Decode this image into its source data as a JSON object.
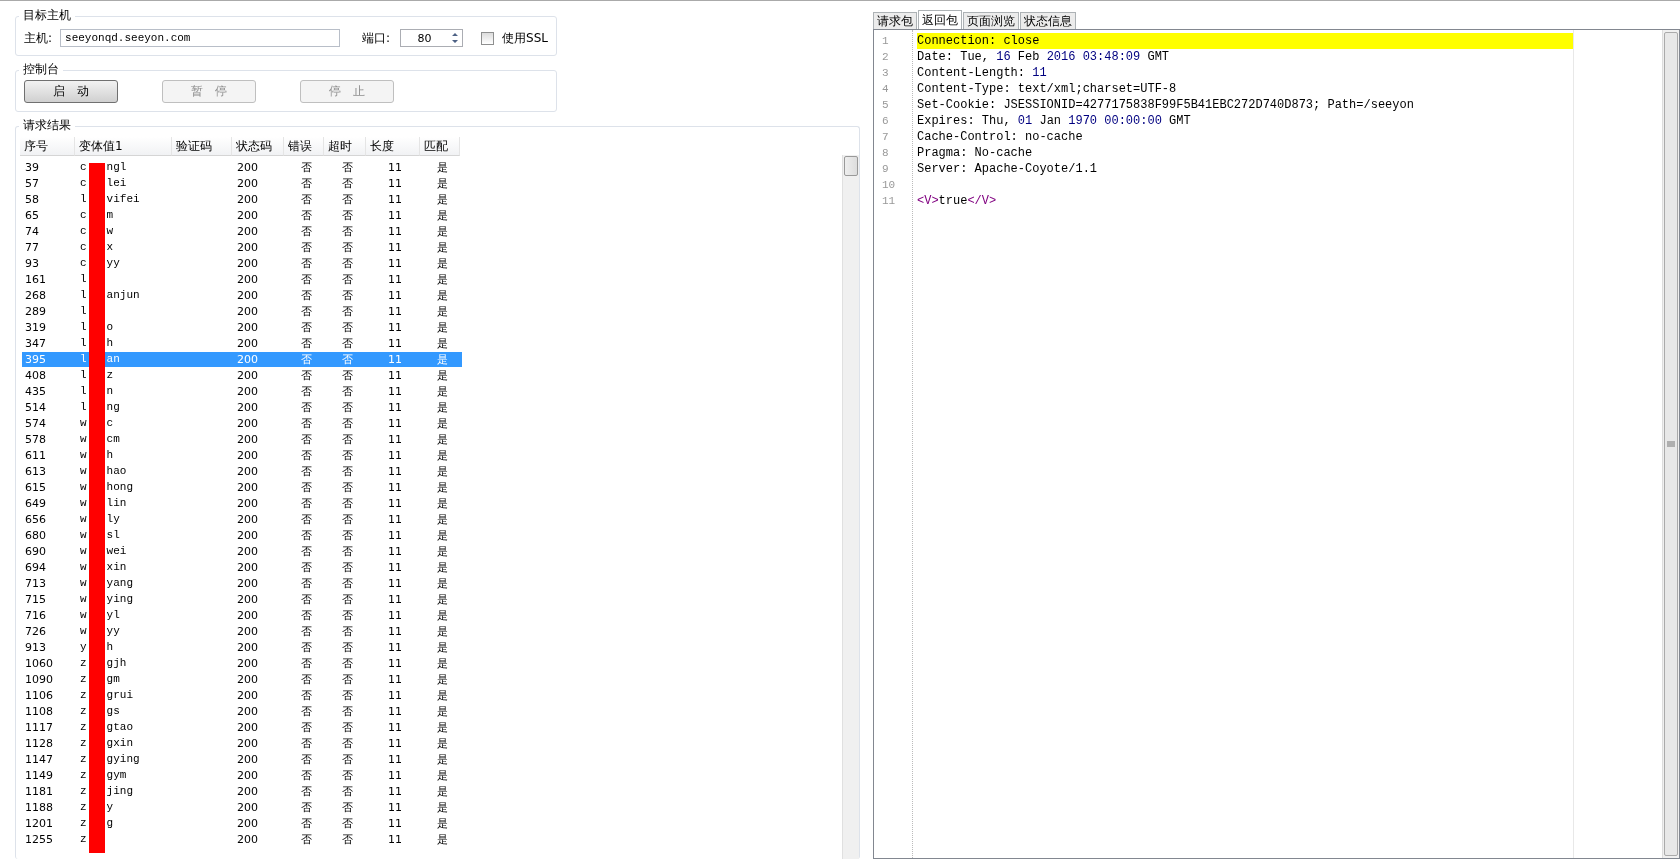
{
  "target_host": {
    "title": "目标主机",
    "host_label": "主机:",
    "host_value": "seeyonqd.seeyon.com",
    "port_label": "端口:",
    "port_value": "80",
    "ssl_label": "使用SSL",
    "ssl_checked": false
  },
  "console": {
    "title": "控制台",
    "buttons": [
      {
        "label": "启　动",
        "disabled": false
      },
      {
        "label": "暂　停",
        "disabled": true
      },
      {
        "label": "停　止",
        "disabled": true
      }
    ]
  },
  "results": {
    "title": "请求结果",
    "columns": [
      "序号",
      "变体值1",
      "验证码",
      "状态码",
      "错误",
      "超时",
      "长度",
      "匹配"
    ],
    "rows": [
      {
        "id": "39",
        "head": "c",
        "tail": "ngl",
        "status": "200",
        "error": "否",
        "timeout": "否",
        "length": "11",
        "match": "是",
        "selected": false
      },
      {
        "id": "57",
        "head": "c",
        "tail": "lei",
        "status": "200",
        "error": "否",
        "timeout": "否",
        "length": "11",
        "match": "是",
        "selected": false
      },
      {
        "id": "58",
        "head": "l",
        "tail": "vifei",
        "status": "200",
        "error": "否",
        "timeout": "否",
        "length": "11",
        "match": "是",
        "selected": false
      },
      {
        "id": "65",
        "head": "c",
        "tail": "m",
        "status": "200",
        "error": "否",
        "timeout": "否",
        "length": "11",
        "match": "是",
        "selected": false
      },
      {
        "id": "74",
        "head": "c",
        "tail": "w",
        "status": "200",
        "error": "否",
        "timeout": "否",
        "length": "11",
        "match": "是",
        "selected": false
      },
      {
        "id": "77",
        "head": "c",
        "tail": "x",
        "status": "200",
        "error": "否",
        "timeout": "否",
        "length": "11",
        "match": "是",
        "selected": false
      },
      {
        "id": "93",
        "head": "c",
        "tail": "yy",
        "status": "200",
        "error": "否",
        "timeout": "否",
        "length": "11",
        "match": "是",
        "selected": false
      },
      {
        "id": "161",
        "head": "l",
        "status": "200",
        "error": "否",
        "timeout": "否",
        "length": "11",
        "match": "是",
        "selected": false
      },
      {
        "id": "268",
        "head": "l",
        "tail": "anjun",
        "status": "200",
        "error": "否",
        "timeout": "否",
        "length": "11",
        "match": "是",
        "selected": false
      },
      {
        "id": "289",
        "head": "l",
        "status": "200",
        "error": "否",
        "timeout": "否",
        "length": "11",
        "match": "是",
        "selected": false
      },
      {
        "id": "319",
        "head": "l",
        "tail": "o",
        "status": "200",
        "error": "否",
        "timeout": "否",
        "length": "11",
        "match": "是",
        "selected": false
      },
      {
        "id": "347",
        "head": "l",
        "tail": "h",
        "status": "200",
        "error": "否",
        "timeout": "否",
        "length": "11",
        "match": "是",
        "selected": false
      },
      {
        "id": "395",
        "head": "l",
        "tail": "an",
        "status": "200",
        "error": "否",
        "timeout": "否",
        "length": "11",
        "match": "是",
        "selected": true
      },
      {
        "id": "408",
        "head": "l",
        "tail": "z",
        "status": "200",
        "error": "否",
        "timeout": "否",
        "length": "11",
        "match": "是",
        "selected": false
      },
      {
        "id": "435",
        "head": "l",
        "tail": "n",
        "status": "200",
        "error": "否",
        "timeout": "否",
        "length": "11",
        "match": "是",
        "selected": false
      },
      {
        "id": "514",
        "head": "l",
        "tail": "ng",
        "status": "200",
        "error": "否",
        "timeout": "否",
        "length": "11",
        "match": "是",
        "selected": false
      },
      {
        "id": "574",
        "head": "w",
        "tail": "c",
        "status": "200",
        "error": "否",
        "timeout": "否",
        "length": "11",
        "match": "是",
        "selected": false
      },
      {
        "id": "578",
        "head": "w",
        "tail": "cm",
        "status": "200",
        "error": "否",
        "timeout": "否",
        "length": "11",
        "match": "是",
        "selected": false
      },
      {
        "id": "611",
        "head": "w",
        "tail": "h",
        "status": "200",
        "error": "否",
        "timeout": "否",
        "length": "11",
        "match": "是",
        "selected": false
      },
      {
        "id": "613",
        "head": "w",
        "tail": "hao",
        "status": "200",
        "error": "否",
        "timeout": "否",
        "length": "11",
        "match": "是",
        "selected": false
      },
      {
        "id": "615",
        "head": "w",
        "tail": "hong",
        "status": "200",
        "error": "否",
        "timeout": "否",
        "length": "11",
        "match": "是",
        "selected": false
      },
      {
        "id": "649",
        "head": "w",
        "tail": "lin",
        "status": "200",
        "error": "否",
        "timeout": "否",
        "length": "11",
        "match": "是",
        "selected": false
      },
      {
        "id": "656",
        "head": "w",
        "tail": "ly",
        "status": "200",
        "error": "否",
        "timeout": "否",
        "length": "11",
        "match": "是",
        "selected": false
      },
      {
        "id": "680",
        "head": "w",
        "tail": "sl",
        "status": "200",
        "error": "否",
        "timeout": "否",
        "length": "11",
        "match": "是",
        "selected": false
      },
      {
        "id": "690",
        "head": "w",
        "tail": "wei",
        "status": "200",
        "error": "否",
        "timeout": "否",
        "length": "11",
        "match": "是",
        "selected": false
      },
      {
        "id": "694",
        "head": "w",
        "tail": "xin",
        "status": "200",
        "error": "否",
        "timeout": "否",
        "length": "11",
        "match": "是",
        "selected": false
      },
      {
        "id": "713",
        "head": "w",
        "tail": "yang",
        "status": "200",
        "error": "否",
        "timeout": "否",
        "length": "11",
        "match": "是",
        "selected": false
      },
      {
        "id": "715",
        "head": "w",
        "tail": "ying",
        "status": "200",
        "error": "否",
        "timeout": "否",
        "length": "11",
        "match": "是",
        "selected": false
      },
      {
        "id": "716",
        "head": "w",
        "tail": "yl",
        "status": "200",
        "error": "否",
        "timeout": "否",
        "length": "11",
        "match": "是",
        "selected": false
      },
      {
        "id": "726",
        "head": "w",
        "tail": "yy",
        "status": "200",
        "error": "否",
        "timeout": "否",
        "length": "11",
        "match": "是",
        "selected": false
      },
      {
        "id": "913",
        "head": "y",
        "tail": "h",
        "status": "200",
        "error": "否",
        "timeout": "否",
        "length": "11",
        "match": "是",
        "selected": false
      },
      {
        "id": "1060",
        "head": "z",
        "tail": "gjh",
        "status": "200",
        "error": "否",
        "timeout": "否",
        "length": "11",
        "match": "是",
        "selected": false
      },
      {
        "id": "1090",
        "head": "z",
        "tail": "gm",
        "status": "200",
        "error": "否",
        "timeout": "否",
        "length": "11",
        "match": "是",
        "selected": false
      },
      {
        "id": "1106",
        "head": "z",
        "tail": "grui",
        "status": "200",
        "error": "否",
        "timeout": "否",
        "length": "11",
        "match": "是",
        "selected": false
      },
      {
        "id": "1108",
        "head": "z",
        "tail": "gs",
        "status": "200",
        "error": "否",
        "timeout": "否",
        "length": "11",
        "match": "是",
        "selected": false
      },
      {
        "id": "1117",
        "head": "z",
        "tail": "gtao",
        "status": "200",
        "error": "否",
        "timeout": "否",
        "length": "11",
        "match": "是",
        "selected": false
      },
      {
        "id": "1128",
        "head": "z",
        "tail": "gxin",
        "status": "200",
        "error": "否",
        "timeout": "否",
        "length": "11",
        "match": "是",
        "selected": false
      },
      {
        "id": "1147",
        "head": "z",
        "tail": "gying",
        "status": "200",
        "error": "否",
        "timeout": "否",
        "length": "11",
        "match": "是",
        "selected": false
      },
      {
        "id": "1149",
        "head": "z",
        "tail": "gym",
        "status": "200",
        "error": "否",
        "timeout": "否",
        "length": "11",
        "match": "是",
        "selected": false
      },
      {
        "id": "1181",
        "head": "z",
        "tail": "jing",
        "status": "200",
        "error": "否",
        "timeout": "否",
        "length": "11",
        "match": "是",
        "selected": false
      },
      {
        "id": "1188",
        "head": "z",
        "tail": "y",
        "status": "200",
        "error": "否",
        "timeout": "否",
        "length": "11",
        "match": "是",
        "selected": false
      },
      {
        "id": "1201",
        "head": "z",
        "tail": "g",
        "status": "200",
        "error": "否",
        "timeout": "否",
        "length": "11",
        "match": "是",
        "selected": false
      },
      {
        "id": "1255",
        "head": "z",
        "status": "200",
        "error": "否",
        "timeout": "否",
        "length": "11",
        "match": "是",
        "selected": false
      }
    ]
  },
  "tabs": [
    {
      "label": "请求包",
      "selected": false
    },
    {
      "label": "返回包",
      "selected": true
    },
    {
      "label": "页面浏览",
      "selected": false
    },
    {
      "label": "状态信息",
      "selected": false
    }
  ],
  "response": {
    "lines": [
      {
        "number": "1",
        "highlighted": true,
        "segments": [
          {
            "kind": "plain",
            "text": "Connection: close"
          }
        ]
      },
      {
        "number": "2",
        "highlighted": false,
        "segments": [
          {
            "kind": "plain",
            "text": "Date: Tue, "
          },
          {
            "kind": "number",
            "text": "16"
          },
          {
            "kind": "plain",
            "text": " Feb "
          },
          {
            "kind": "number",
            "text": "2016"
          },
          {
            "kind": "number",
            "text": " 03:48:09"
          },
          {
            "kind": "plain",
            "text": " GMT"
          }
        ]
      },
      {
        "number": "3",
        "highlighted": false,
        "segments": [
          {
            "kind": "plain",
            "text": "Content-Length: "
          },
          {
            "kind": "number",
            "text": "11"
          }
        ]
      },
      {
        "number": "4",
        "highlighted": false,
        "segments": [
          {
            "kind": "plain",
            "text": "Content-Type: text/xml;charset=UTF-8"
          }
        ]
      },
      {
        "number": "5",
        "highlighted": false,
        "segments": [
          {
            "kind": "plain",
            "text": "Set-Cookie: JSESSIONID=4277175838F99F5B41EBC272D740D873; Path=/seeyon"
          }
        ]
      },
      {
        "number": "6",
        "highlighted": false,
        "segments": [
          {
            "kind": "plain",
            "text": "Expires: Thu, "
          },
          {
            "kind": "number",
            "text": "01"
          },
          {
            "kind": "plain",
            "text": " Jan "
          },
          {
            "kind": "number",
            "text": "1970"
          },
          {
            "kind": "number",
            "text": " 00:00:00"
          },
          {
            "kind": "plain",
            "text": " GMT"
          }
        ]
      },
      {
        "number": "7",
        "highlighted": false,
        "segments": [
          {
            "kind": "plain",
            "text": "Cache-Control: no-cache"
          }
        ]
      },
      {
        "number": "8",
        "highlighted": false,
        "segments": [
          {
            "kind": "plain",
            "text": "Pragma: No-cache"
          }
        ]
      },
      {
        "number": "9",
        "highlighted": false,
        "segments": [
          {
            "kind": "plain",
            "text": "Server: Apache-Coyote/1.1"
          }
        ]
      },
      {
        "number": "10",
        "highlighted": false
      },
      {
        "number": "11",
        "highlighted": false,
        "segments": [
          {
            "kind": "tag",
            "text": "<V>"
          },
          {
            "kind": "plain",
            "text": "true"
          },
          {
            "kind": "tag",
            "text": "</V>"
          }
        ]
      }
    ]
  }
}
